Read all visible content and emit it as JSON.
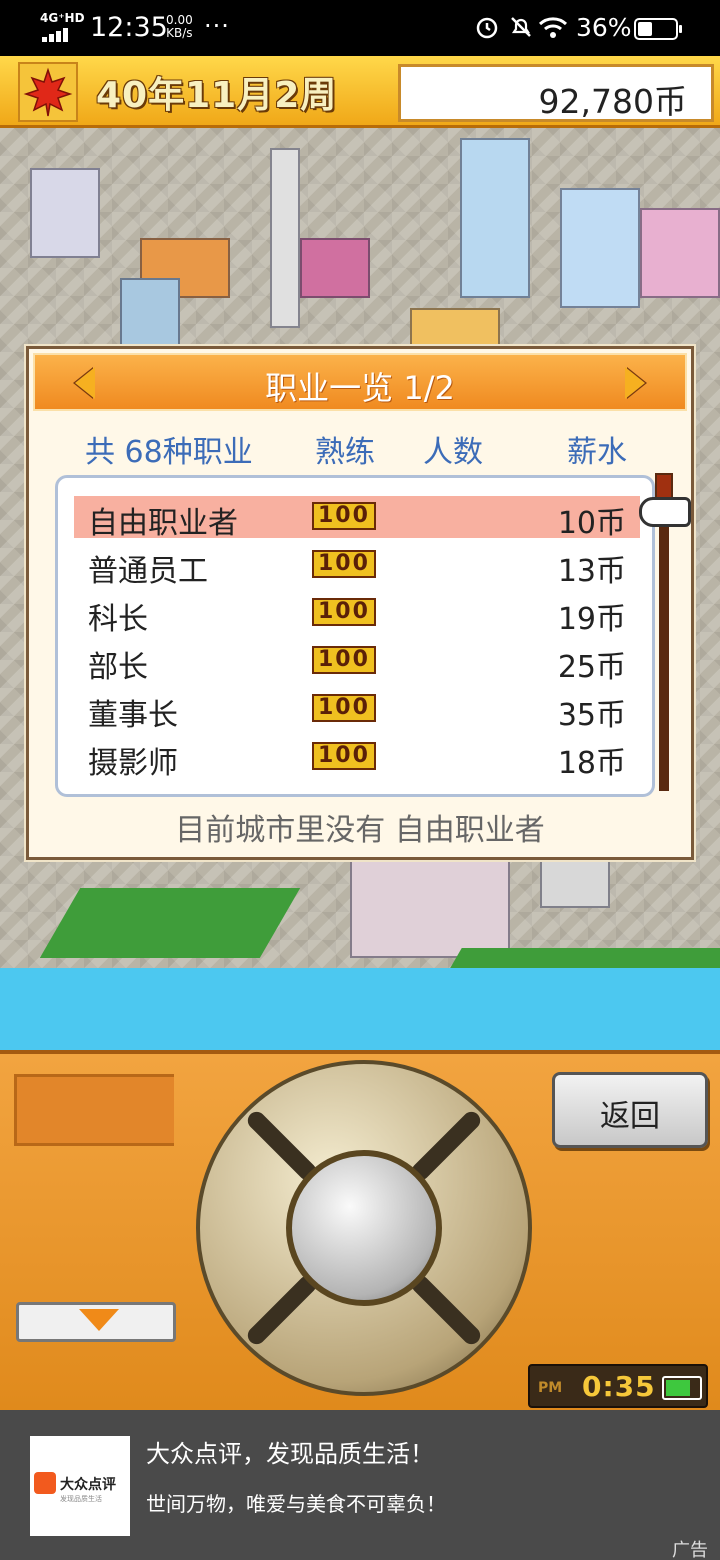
{
  "status_bar": {
    "network": "4G⁺HD",
    "time": "12:35",
    "speed_value": "0.00",
    "speed_unit": "KB/s",
    "more": "···",
    "battery_percent": "36%"
  },
  "top_bar": {
    "date": "40年11月2周",
    "money": "92,780币"
  },
  "job_panel": {
    "title": "职业一览 1/2",
    "columns": {
      "count_label": "共 68种职业",
      "skill": "熟练",
      "people": "人数",
      "salary": "薪水"
    },
    "jobs": [
      {
        "name": "自由职业者",
        "skill": "100",
        "salary": "10币"
      },
      {
        "name": "普通员工",
        "skill": "100",
        "salary": "13币"
      },
      {
        "name": "科长",
        "skill": "100",
        "salary": "19币"
      },
      {
        "name": "部长",
        "skill": "100",
        "salary": "25币"
      },
      {
        "name": "董事长",
        "skill": "100",
        "salary": "35币"
      },
      {
        "name": "摄影师",
        "skill": "100",
        "salary": "18币"
      }
    ],
    "selected_index": 0,
    "status_message": "目前城市里没有 自由职业者"
  },
  "controller": {
    "back_label": "返回",
    "clock_ampm": "PM",
    "clock_time": "0:35"
  },
  "ad": {
    "brand": "大众点评",
    "slogan": "发现品质生活",
    "title": "大众点评，发现品质生活！",
    "subtitle": "世间万物，唯爱与美食不可辜负！",
    "tag": "广告"
  },
  "colors": {
    "accent_orange": "#f08a20",
    "header_blue": "#3c6cb8",
    "selected_row": "#f8b0a0",
    "water": "#4cc8f0"
  }
}
